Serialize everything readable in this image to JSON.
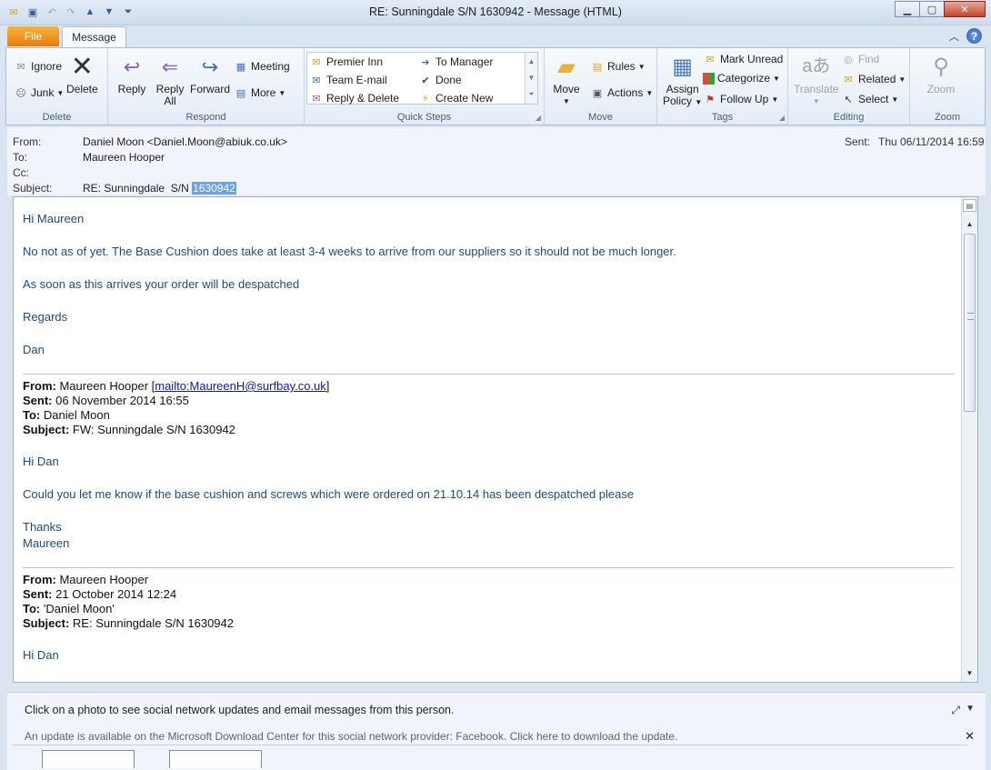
{
  "window": {
    "title": "RE: Sunningdale  S/N  1630942  -  Message (HTML)"
  },
  "tabs": [
    {
      "label": "File"
    },
    {
      "label": "Message"
    }
  ],
  "ribbon": {
    "delete_group": {
      "label": "Delete",
      "ignore": "Ignore",
      "junk": "Junk",
      "delete": "Delete"
    },
    "respond_group": {
      "label": "Respond",
      "reply": "Reply",
      "reply_all_1": "Reply",
      "reply_all_2": "All",
      "forward": "Forward",
      "meeting": "Meeting",
      "more": "More"
    },
    "quick_steps": {
      "label": "Quick Steps",
      "items": [
        "Premier Inn",
        "Team E-mail",
        "Reply & Delete",
        "To Manager",
        "Done",
        "Create New"
      ]
    },
    "move_group": {
      "label": "Move",
      "move": "Move",
      "rules": "Rules",
      "actions": "Actions"
    },
    "tags_group": {
      "label": "Tags",
      "assign_1": "Assign",
      "assign_2": "Policy",
      "mark_unread": "Mark Unread",
      "categorize": "Categorize",
      "follow_up": "Follow Up"
    },
    "editing_group": {
      "label": "Editing",
      "translate": "Translate",
      "find": "Find",
      "related": "Related",
      "select": "Select"
    },
    "zoom_group": {
      "label": "Zoom",
      "zoom": "Zoom"
    }
  },
  "header": {
    "from_label": "From:",
    "from_value": "Daniel Moon <Daniel.Moon@abiuk.co.uk>",
    "to_label": "To:",
    "to_value": "Maureen Hooper",
    "cc_label": "Cc:",
    "subject_label": "Subject:",
    "subject_prefix": "RE: Sunningdale  S/N ",
    "subject_selected": "1630942",
    "sent_label": "Sent:",
    "sent_value": "Thu 06/11/2014 16:59"
  },
  "body": {
    "greeting": "Hi Maureen",
    "line1": "No not as of yet. The Base Cushion does take at least 3-4 weeks to arrive from our suppliers so it should not be much longer.",
    "line2": "As soon as this arrives your order will be despatched",
    "line3": "Regards",
    "sign": "Dan",
    "quote1": {
      "from_label": "From:",
      "from_name": "Maureen Hooper [",
      "from_link": "mailto:MaureenH@surfbay.co.uk",
      "from_close": "]",
      "sent_label": "Sent:",
      "sent_value": "06 November 2014 16:55",
      "to_label": "To:",
      "to_value": "Daniel Moon",
      "subject_label": "Subject:",
      "subject_value": "FW: Sunningdale S/N 1630942",
      "greeting": "Hi Dan",
      "line1": "Could you let me know if the base cushion and screws which were ordered on 21.10.14 has been despatched please",
      "thanks": "Thanks",
      "sign": "Maureen"
    },
    "quote2": {
      "from_label": "From:",
      "from_value": "Maureen Hooper",
      "sent_label": "Sent:",
      "sent_value": "21 October 2014 12:24",
      "to_label": "To:",
      "to_value": "'Daniel Moon'",
      "subject_label": "Subject:",
      "subject_value": "RE: Sunningdale S/N 1630942",
      "greeting": "Hi Dan"
    }
  },
  "social": {
    "text": "Click on a photo to see social network updates and email messages from this person.",
    "update": "An update is available on the Microsoft Download Center for this social network provider: Facebook. Click here to download the update."
  }
}
